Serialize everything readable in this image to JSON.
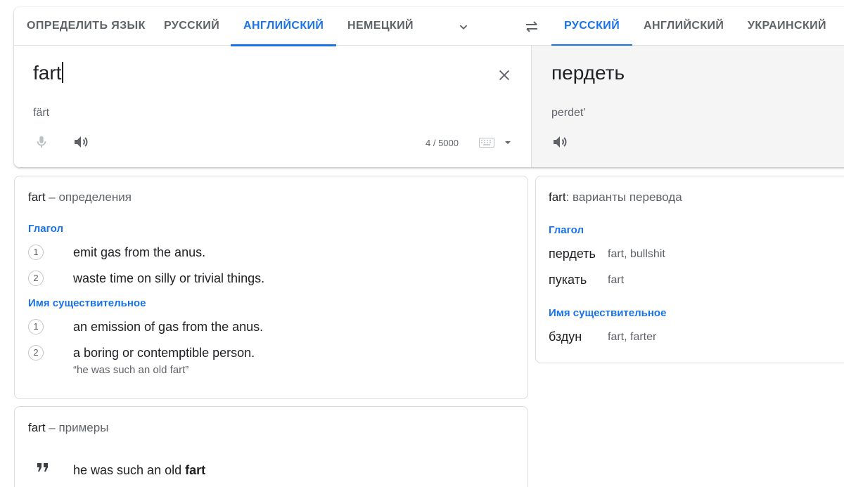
{
  "source_languages": [
    "ОПРЕДЕЛИТЬ ЯЗЫК",
    "РУССКИЙ",
    "АНГЛИЙСКИЙ",
    "НЕМЕЦКИЙ"
  ],
  "target_languages": [
    "РУССКИЙ",
    "АНГЛИЙСКИЙ",
    "УКРАИНСКИЙ"
  ],
  "source": {
    "text": "fart",
    "transliteration": "färt",
    "char_count": "4 / 5000"
  },
  "target": {
    "text": "пердеть",
    "transliteration": "perdet'"
  },
  "definitions": {
    "word": "fart",
    "subtitle": " – определения",
    "groups": [
      {
        "pos": "Глагол",
        "items": [
          {
            "num": "1",
            "text": "emit gas from the anus.",
            "example": ""
          },
          {
            "num": "2",
            "text": "waste time on silly or trivial things.",
            "example": ""
          }
        ]
      },
      {
        "pos": "Имя существительное",
        "items": [
          {
            "num": "1",
            "text": "an emission of gas from the anus.",
            "example": ""
          },
          {
            "num": "2",
            "text": "a boring or contemptible person.",
            "example": "“he was such an old fart”"
          }
        ]
      }
    ]
  },
  "translations": {
    "word": "fart",
    "subtitle": ": варианты перевода",
    "groups": [
      {
        "pos": "Глагол",
        "items": [
          {
            "word": "пердеть",
            "synonyms": "fart, bullshit"
          },
          {
            "word": "пукать",
            "synonyms": "fart"
          }
        ]
      },
      {
        "pos": "Имя существительное",
        "items": [
          {
            "word": "бздун",
            "synonyms": "fart, farter"
          }
        ]
      }
    ]
  },
  "examples": {
    "word": "fart",
    "subtitle": " – примеры",
    "items": [
      {
        "prefix": "he was such an old ",
        "bold": "fart"
      }
    ]
  },
  "icons": {
    "expand": "chevron-down-icon",
    "swap": "swap-arrows-icon",
    "clear": "close-icon",
    "mic": "microphone-icon",
    "speaker": "speaker-icon",
    "keyboard": "keyboard-icon",
    "quote": "quote-icon"
  },
  "colors": {
    "accent": "#1a73e8",
    "text": "#202124",
    "secondary": "#5f6368",
    "target_bg": "#f5f5f5"
  }
}
